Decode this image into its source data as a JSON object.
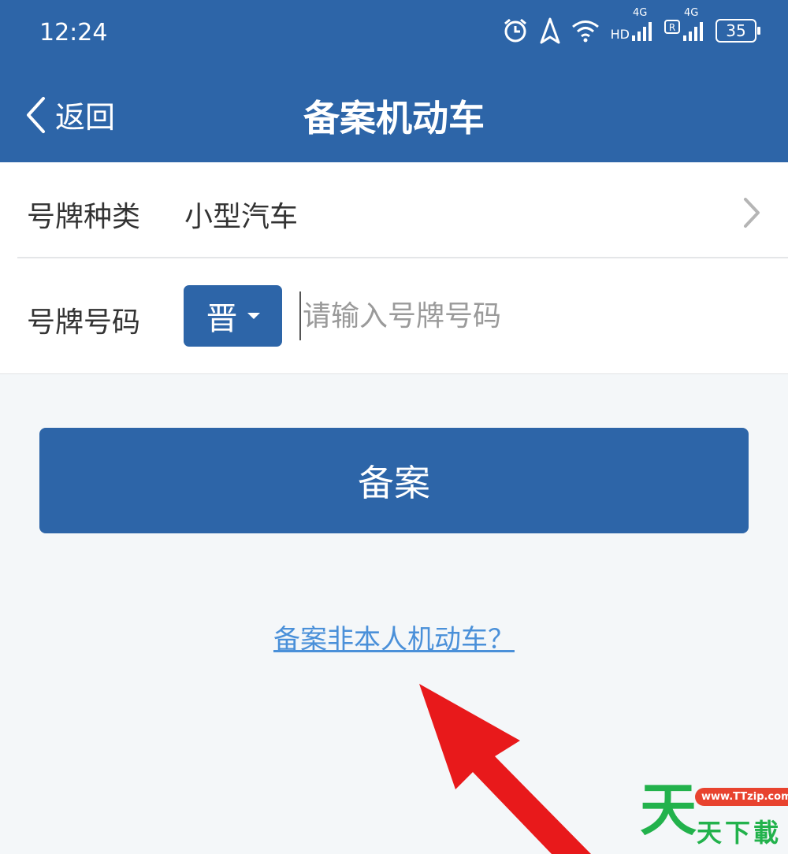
{
  "status_bar": {
    "time": "12:24",
    "network_label": "HD",
    "network_4g": "4G",
    "battery": "35"
  },
  "nav": {
    "back_label": "返回",
    "title": "备案机动车"
  },
  "form": {
    "plate_type": {
      "label": "号牌种类",
      "value": "小型汽车"
    },
    "plate_number": {
      "label": "号牌号码",
      "province": "晋",
      "placeholder": "请输入号牌号码"
    }
  },
  "submit_label": "备案",
  "other_vehicle_link": "备案非本人机动车？",
  "watermark": {
    "big": "天",
    "url": "www.TTzip.com",
    "sub": "天下載"
  },
  "colors": {
    "primary": "#2d65a8",
    "link": "#4a90d9",
    "arrow": "#e8191b",
    "watermark": "#22b24c"
  },
  "icons": [
    "alarm-icon",
    "location-icon",
    "wifi-icon",
    "signal-icon",
    "battery-icon",
    "back-chevron-icon",
    "chevron-right-icon",
    "caret-down-icon",
    "red-arrow"
  ]
}
